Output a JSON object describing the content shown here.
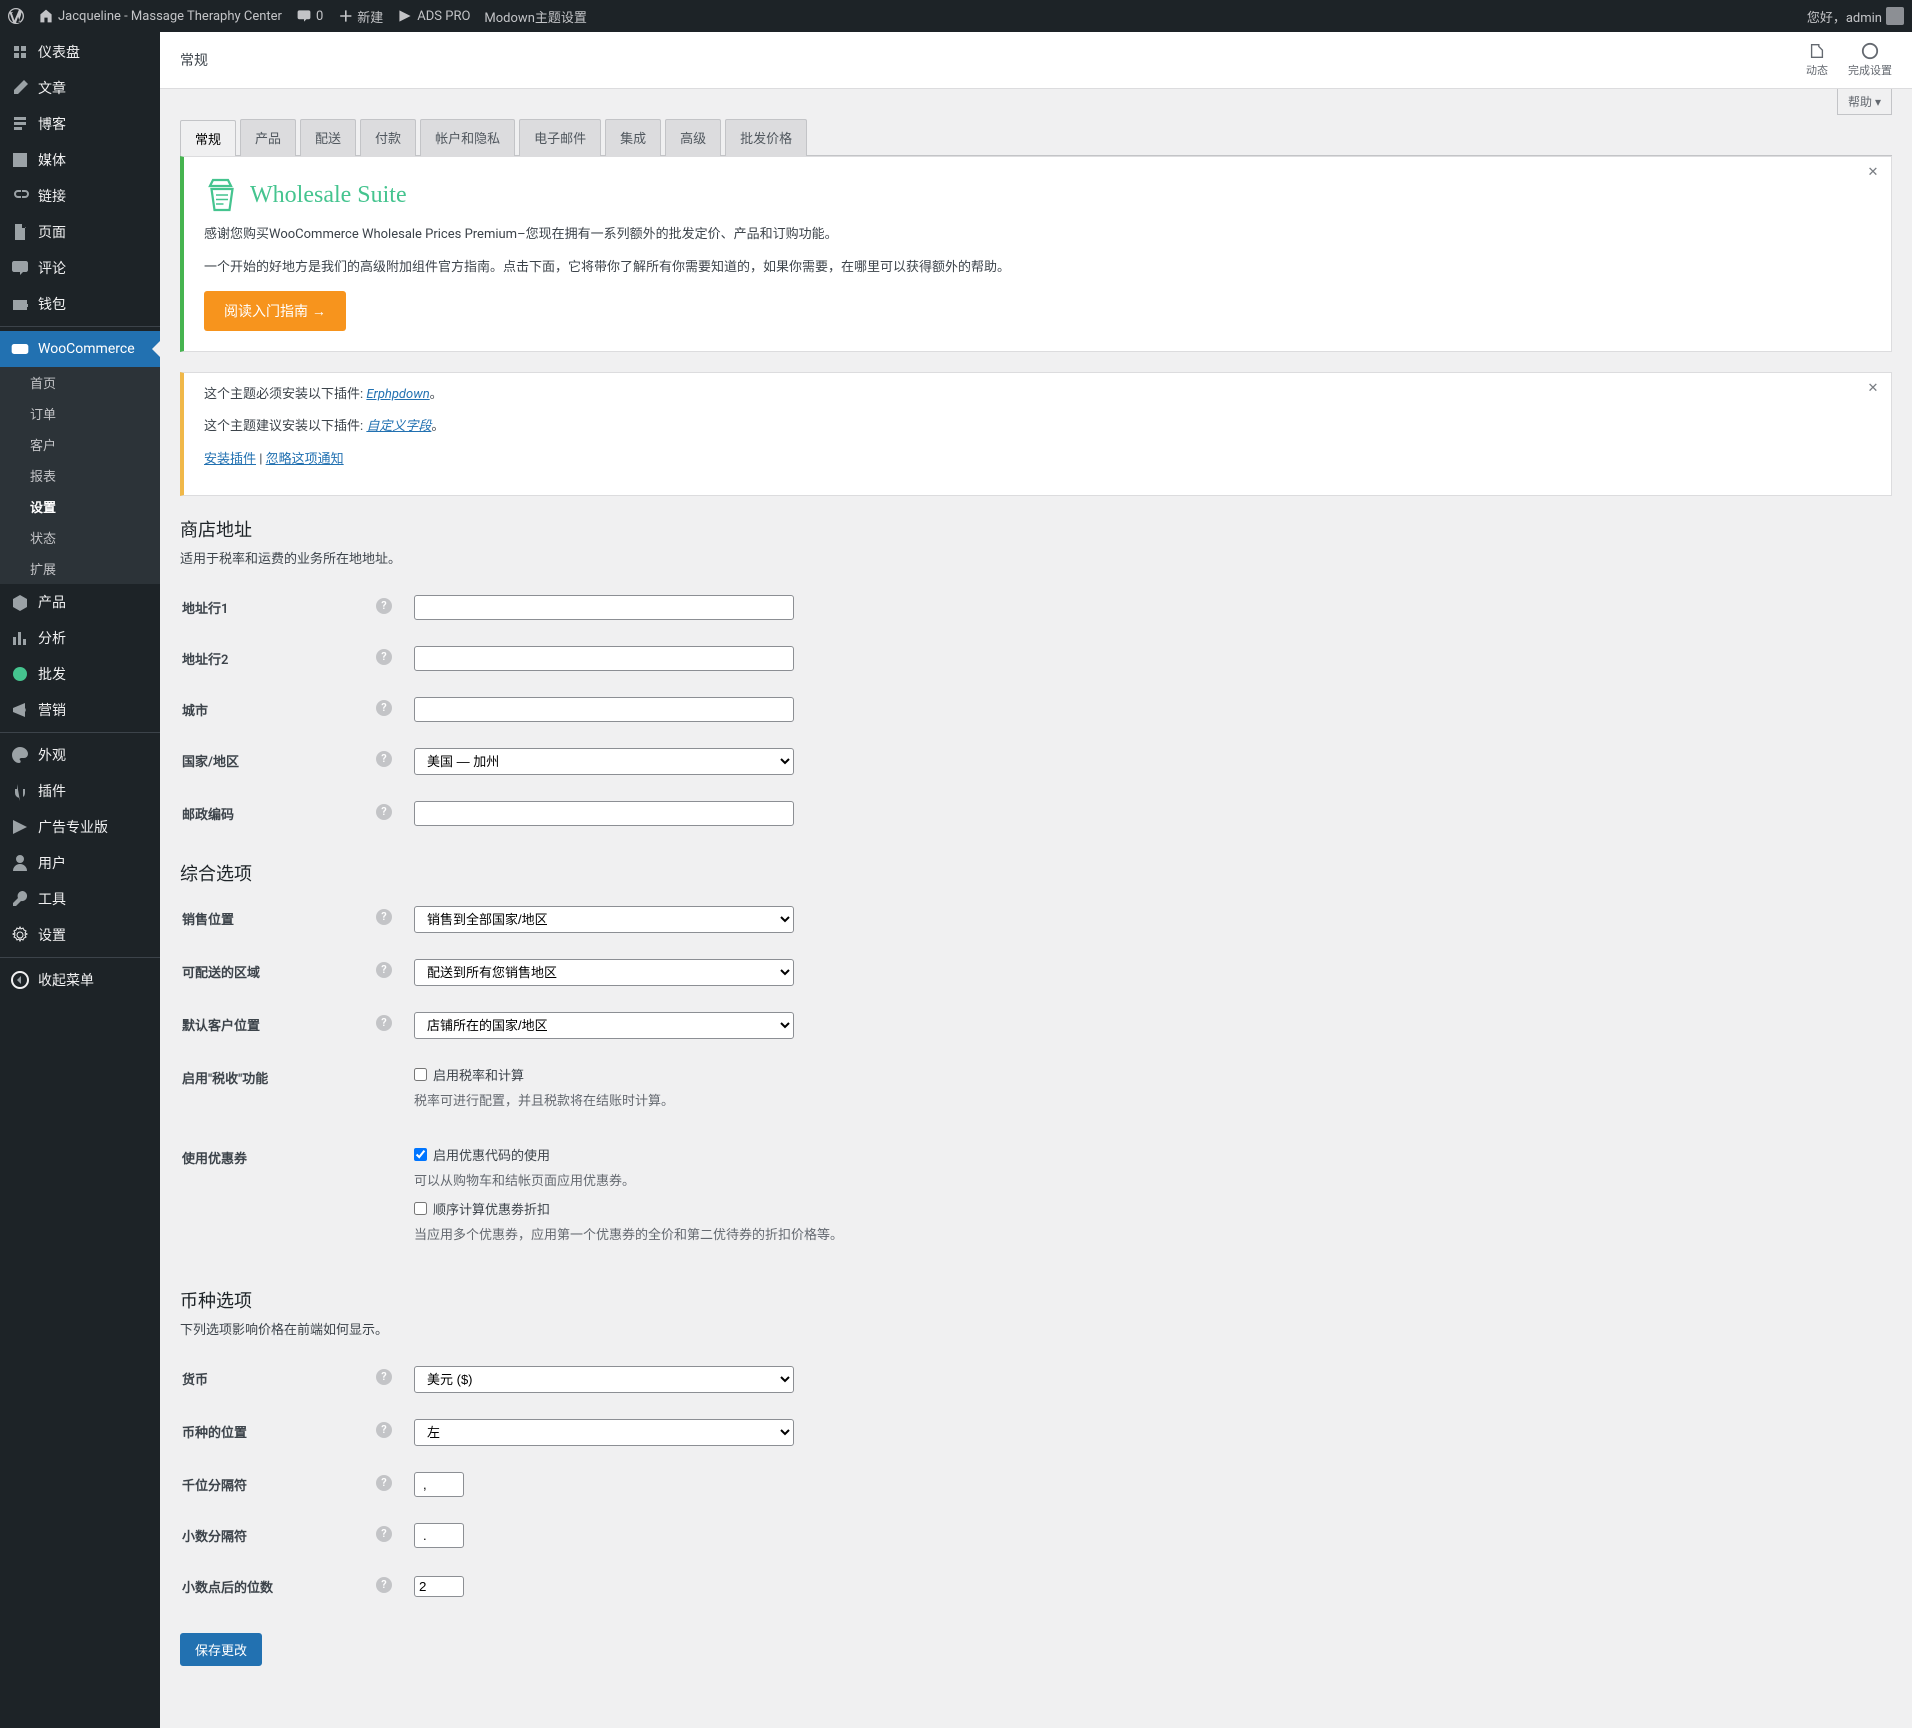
{
  "adminbar": {
    "site_name": "Jacqueline - Massage Theraphy Center",
    "comments": "0",
    "new": "新建",
    "ads": "ADS PRO",
    "modown": "Modown主题设置",
    "greeting": "您好，admin"
  },
  "sidebar": {
    "items": [
      {
        "label": "仪表盘",
        "icon": "dashboard"
      },
      {
        "label": "文章",
        "icon": "post"
      },
      {
        "label": "博客",
        "icon": "blog"
      },
      {
        "label": "媒体",
        "icon": "media"
      },
      {
        "label": "链接",
        "icon": "link"
      },
      {
        "label": "页面",
        "icon": "page"
      },
      {
        "label": "评论",
        "icon": "comment"
      },
      {
        "label": "钱包",
        "icon": "wallet"
      }
    ],
    "woo": "WooCommerce",
    "woo_sub": [
      "首页",
      "订单",
      "客户",
      "报表",
      "设置",
      "状态",
      "扩展"
    ],
    "woo_sub_current": 4,
    "items2": [
      {
        "label": "产品",
        "icon": "product"
      },
      {
        "label": "分析",
        "icon": "analytics"
      },
      {
        "label": "批发",
        "icon": "wholesale"
      },
      {
        "label": "营销",
        "icon": "marketing"
      }
    ],
    "items3": [
      {
        "label": "外观",
        "icon": "appearance"
      },
      {
        "label": "插件",
        "icon": "plugins"
      },
      {
        "label": "广告专业版",
        "icon": "ads"
      },
      {
        "label": "用户",
        "icon": "users"
      },
      {
        "label": "工具",
        "icon": "tools"
      },
      {
        "label": "设置",
        "icon": "settings"
      }
    ],
    "collapse": "收起菜单"
  },
  "header": {
    "title": "常规",
    "activity": "动态",
    "finish": "完成设置",
    "help": "帮助 ▾"
  },
  "tabs": [
    "常规",
    "产品",
    "配送",
    "付款",
    "帐户和隐私",
    "电子邮件",
    "集成",
    "高级",
    "批发价格"
  ],
  "tabs_active": 0,
  "wholesale": {
    "title": "Wholesale Suite",
    "p1": "感谢您购买WooCommerce Wholesale Prices Premium–您现在拥有一系列额外的批发定价、产品和订购功能。",
    "p2": "一个开始的好地方是我们的高级附加组件官方指南。点击下面，它将带你了解所有你需要知道的，如果你需要，在哪里可以获得额外的帮助。",
    "cta": "阅读入门指南 →"
  },
  "warning": {
    "l1a": "这个主题必须安装以下插件: ",
    "l1b": "Erphpdown",
    "l2a": "这个主题建议安装以下插件: ",
    "l2b": "自定义字段",
    "install": "安装插件",
    "dismiss": "忽略这项通知",
    "sep": "。",
    "bar": " | "
  },
  "sections": {
    "store": {
      "h": "商店地址",
      "d": "适用于税率和运费的业务所在地地址。"
    },
    "general": {
      "h": "综合选项"
    },
    "currency": {
      "h": "币种选项",
      "d": "下列选项影响价格在前端如何显示。"
    }
  },
  "fields": {
    "addr1": {
      "label": "地址行1",
      "value": ""
    },
    "addr2": {
      "label": "地址行2",
      "value": ""
    },
    "city": {
      "label": "城市",
      "value": ""
    },
    "country": {
      "label": "国家/地区",
      "value": "美国 — 加州"
    },
    "postcode": {
      "label": "邮政编码",
      "value": ""
    },
    "sell_to": {
      "label": "销售位置",
      "value": "销售到全部国家/地区"
    },
    "ship_to": {
      "label": "可配送的区域",
      "value": "配送到所有您销售地区"
    },
    "def_loc": {
      "label": "默认客户位置",
      "value": "店铺所在的国家/地区"
    },
    "tax": {
      "label": "启用\"税收\"功能",
      "cb": "启用税率和计算",
      "desc": "税率可进行配置，并且税款将在结账时计算。"
    },
    "coupon": {
      "label": "使用优惠券",
      "cb1": "启用优惠代码的使用",
      "desc1": "可以从购物车和结帐页面应用优惠券。",
      "cb2": "顺序计算优惠劵折扣",
      "desc2": "当应用多个优惠券，应用第一个优惠券的全价和第二优待券的折扣价格等。"
    },
    "currency": {
      "label": "货币",
      "value": "美元 ($)"
    },
    "cur_pos": {
      "label": "币种的位置",
      "value": "左"
    },
    "thou_sep": {
      "label": "千位分隔符",
      "value": ","
    },
    "dec_sep": {
      "label": "小数分隔符",
      "value": "."
    },
    "decimals": {
      "label": "小数点后的位数",
      "value": "2"
    }
  },
  "save": "保存更改"
}
